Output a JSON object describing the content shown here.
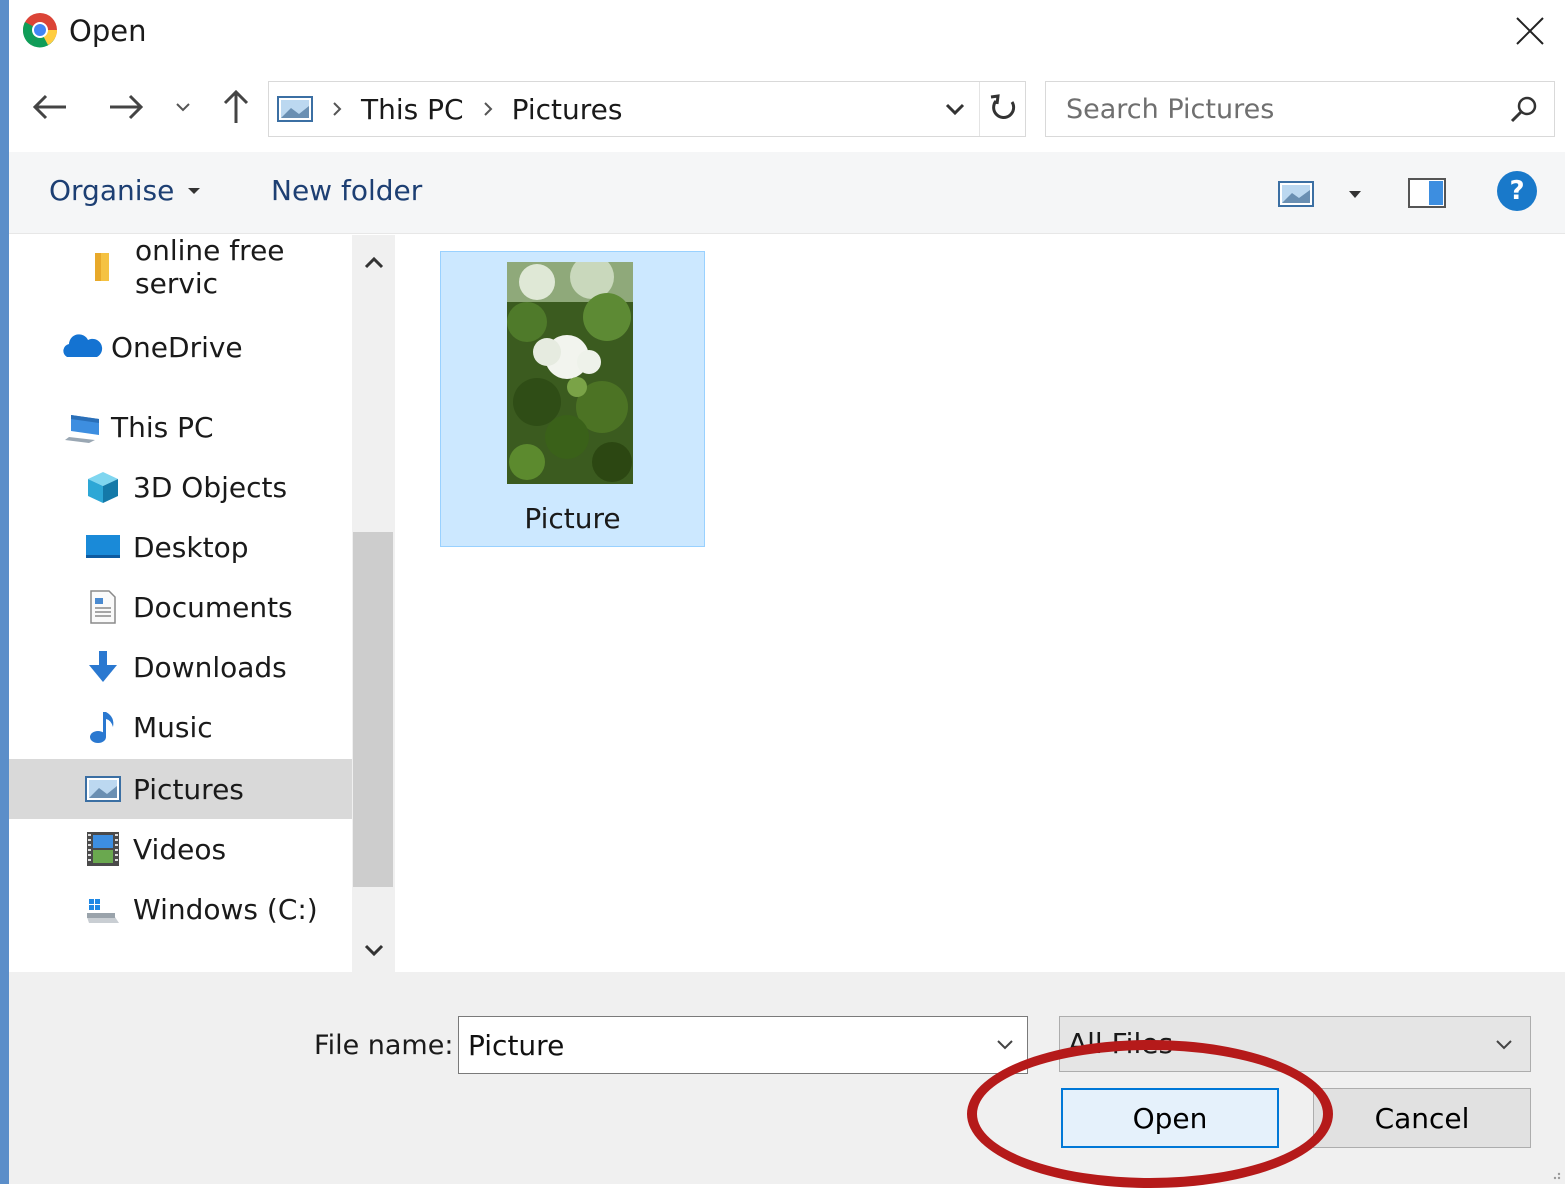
{
  "window": {
    "title": "Open"
  },
  "address": {
    "crumbs": [
      "This PC",
      "Pictures"
    ]
  },
  "search": {
    "placeholder": "Search Pictures"
  },
  "toolbar": {
    "organise": "Organise",
    "new_folder": "New folder",
    "help": "?"
  },
  "sidebar": {
    "items": [
      {
        "label": "online free servic",
        "icon": "folder-icon"
      },
      {
        "label": "OneDrive",
        "icon": "cloud-icon"
      },
      {
        "label": "This PC",
        "icon": "computer-icon"
      },
      {
        "label": "3D Objects",
        "icon": "cube-icon"
      },
      {
        "label": "Desktop",
        "icon": "desktop-icon"
      },
      {
        "label": "Documents",
        "icon": "document-icon"
      },
      {
        "label": "Downloads",
        "icon": "download-arrow-icon"
      },
      {
        "label": "Music",
        "icon": "music-note-icon"
      },
      {
        "label": "Pictures",
        "icon": "pictures-icon",
        "selected": true
      },
      {
        "label": "Videos",
        "icon": "film-icon"
      },
      {
        "label": "Windows (C:)",
        "icon": "drive-icon"
      }
    ]
  },
  "files": [
    {
      "name": "Picture",
      "selected": true
    }
  ],
  "footer": {
    "file_name_label": "File name:",
    "file_name_value": "Picture",
    "filter_value": "All Files",
    "open_label": "Open",
    "cancel_label": "Cancel"
  },
  "colors": {
    "accent": "#0078d7",
    "selection": "#cce8ff",
    "annotation": "#b51a1a"
  }
}
